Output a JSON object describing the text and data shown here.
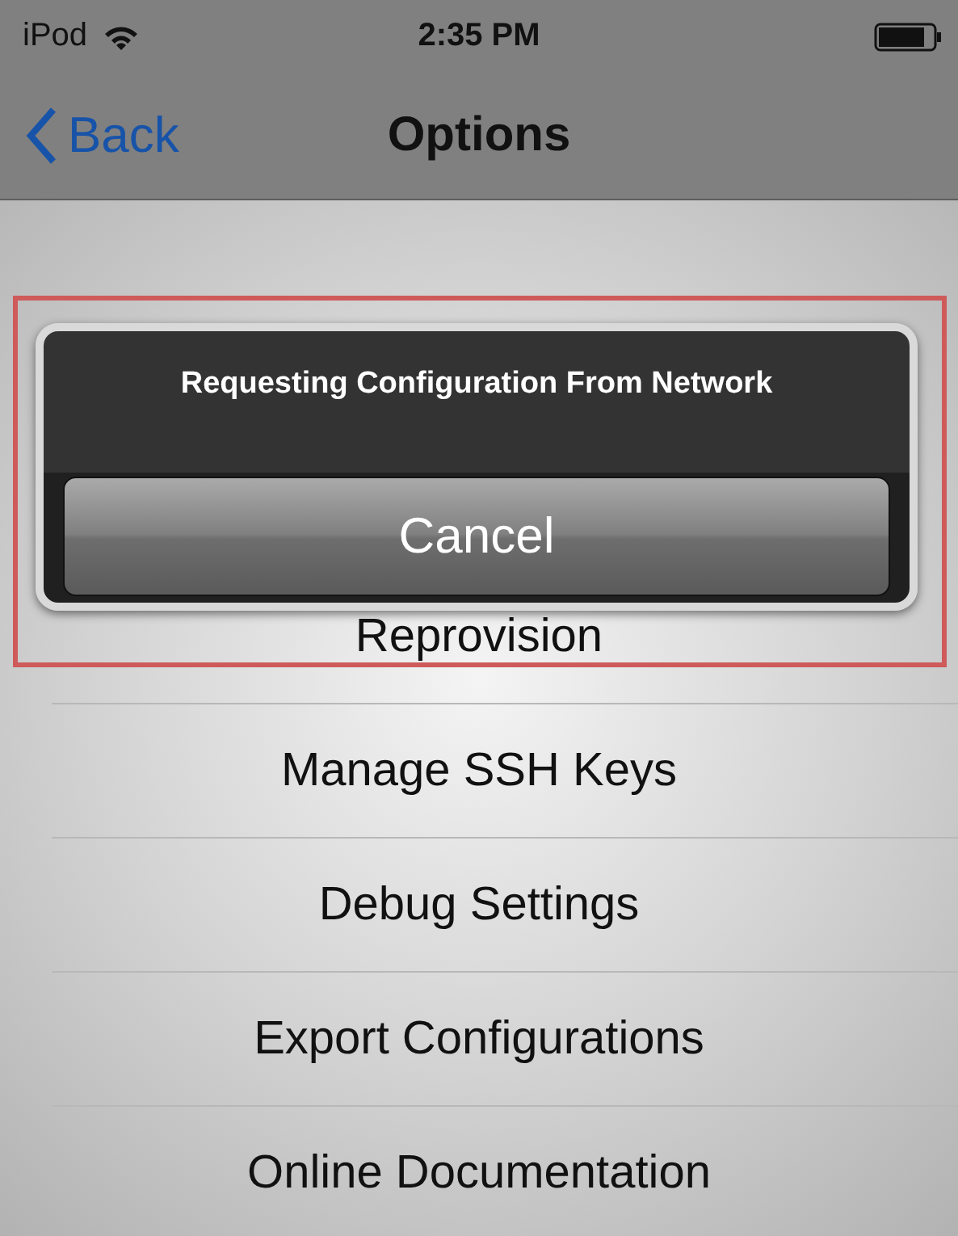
{
  "status_bar": {
    "carrier": "iPod",
    "time": "2:35 PM"
  },
  "nav_bar": {
    "back": "Back",
    "title": "Options"
  },
  "items": [
    {
      "label": "Reprovision"
    },
    {
      "label": "Manage SSH Keys"
    },
    {
      "label": "Debug Settings"
    },
    {
      "label": "Export Configurations"
    },
    {
      "label": "Online Documentation"
    }
  ],
  "alert": {
    "message": "Requesting Configuration From Network",
    "button": "Cancel"
  }
}
